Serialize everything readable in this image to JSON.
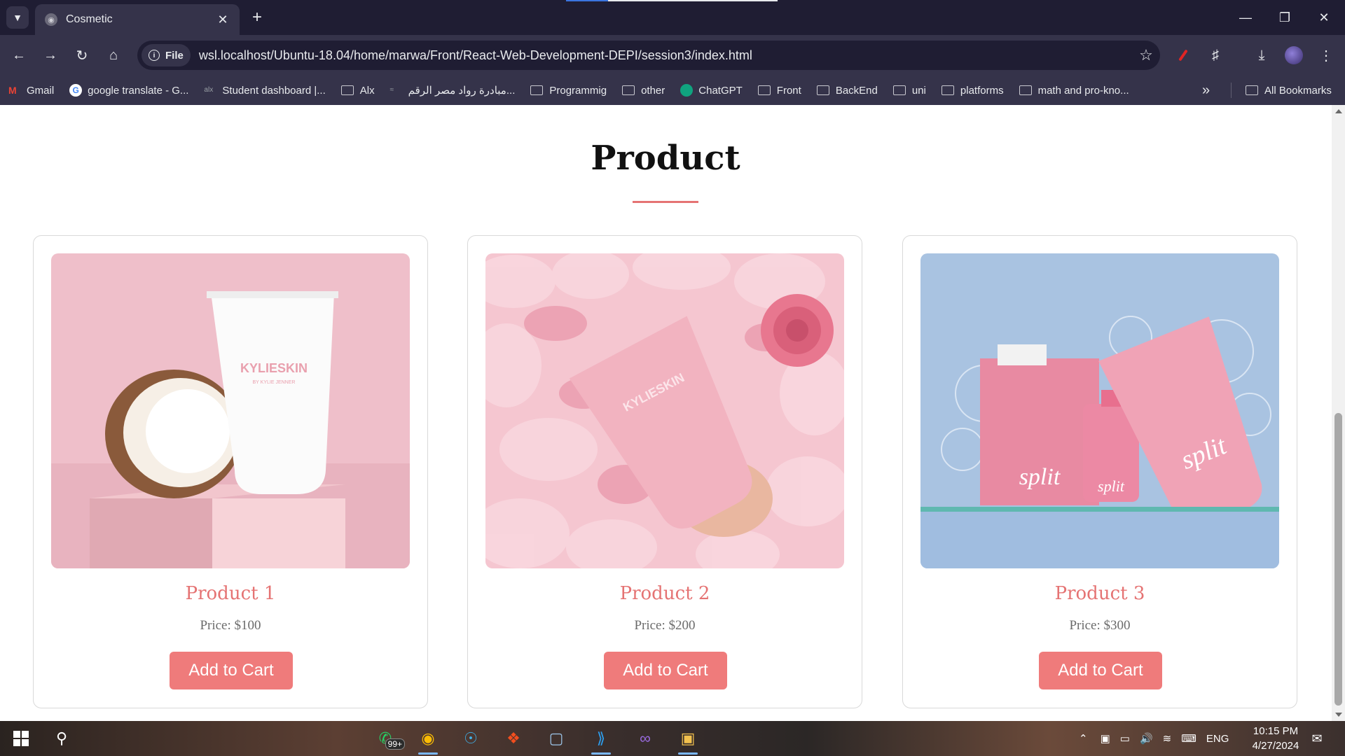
{
  "browser": {
    "tab_title": "Cosmetic",
    "url": "wsl.localhost/Ubuntu-18.04/home/marwa/Front/React-Web-Development-DEPI/session3/index.html",
    "site_info_label": "File",
    "bookmarks": [
      {
        "label": "Gmail",
        "icon": "gmail-icon"
      },
      {
        "label": "google translate - G...",
        "icon": "google-icon"
      },
      {
        "label": "Student dashboard |...",
        "icon": "alx-icon"
      },
      {
        "label": "Alx",
        "icon": "folder-icon"
      },
      {
        "label": "مبادرة رواد مصر الرقم...",
        "icon": "rowad-icon"
      },
      {
        "label": "Programmig",
        "icon": "folder-icon"
      },
      {
        "label": "other",
        "icon": "folder-icon"
      },
      {
        "label": "ChatGPT",
        "icon": "chatgpt-icon"
      },
      {
        "label": "Front",
        "icon": "folder-icon"
      },
      {
        "label": "BackEnd",
        "icon": "folder-icon"
      },
      {
        "label": "uni",
        "icon": "folder-icon"
      },
      {
        "label": "platforms",
        "icon": "folder-icon"
      },
      {
        "label": "math and pro-kno...",
        "icon": "folder-icon"
      }
    ],
    "all_bookmarks_label": "All Bookmarks"
  },
  "page": {
    "section_title": "Product",
    "accent_color": "#e57373",
    "products": [
      {
        "name": "Product 1",
        "price": "Price: $100",
        "button": "Add to Cart",
        "image": "kylie-skin-lotion-coconut"
      },
      {
        "name": "Product 2",
        "price": "Price: $200",
        "button": "Add to Cart",
        "image": "kylie-skin-tube-rose-petals"
      },
      {
        "name": "Product 3",
        "price": "Price: $300",
        "button": "Add to Cart",
        "image": "split-products-bubbles"
      }
    ]
  },
  "taskbar": {
    "whatsapp_badge": "99+",
    "language": "ENG",
    "time": "10:15 PM",
    "date": "4/27/2024"
  }
}
